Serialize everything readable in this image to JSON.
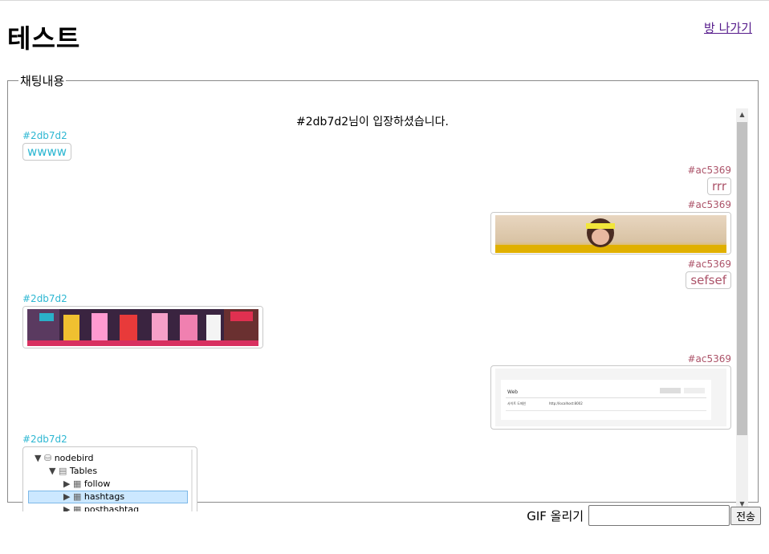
{
  "header": {
    "title": "테스트",
    "exit_link": "방 나가기"
  },
  "chat": {
    "legend": "채팅내용",
    "system_message": "#2db7d2님이 입장하셨습니다.",
    "messages": [
      {
        "user": "#2db7d2",
        "text": "wwww",
        "side": "other"
      },
      {
        "user": "#ac5369",
        "text": "rrr",
        "side": "mine"
      },
      {
        "user": "#ac5369",
        "gif": "dancer-yellow-headband",
        "side": "mine"
      },
      {
        "user": "#ac5369",
        "text": "sefsef",
        "side": "mine"
      },
      {
        "user": "#2db7d2",
        "gif": "group-dance-neon-stage",
        "side": "other"
      },
      {
        "user": "#ac5369",
        "gif": "web-settings-screenshot",
        "side": "mine"
      },
      {
        "user": "#2db7d2",
        "gif": "db-tree-screenshot",
        "side": "other"
      }
    ],
    "screenshot_text": {
      "web_title": "Web",
      "web_row_label": "사이트 도메인",
      "web_row_value": "http://localhost:8002",
      "tree_db": "nodebird",
      "tree_tables": "Tables",
      "tree_items": [
        "follow",
        "hashtags",
        "posthashtag"
      ]
    }
  },
  "form": {
    "label": "GIF 올리기",
    "input_value": "",
    "send_label": "전송"
  },
  "colors": {
    "mine": "#ac5369",
    "other": "#2db7d2",
    "link": "#551a8b"
  }
}
